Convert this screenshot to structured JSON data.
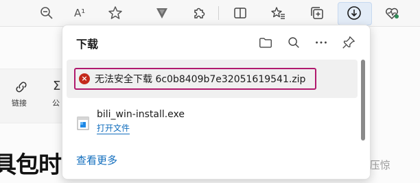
{
  "toolbar": {
    "icons": [
      "zoom-out-icon",
      "read-aloud-icon",
      "favorite-star-icon",
      "vivaldi-extension-icon",
      "extensions-puzzle-icon",
      "split-screen-icon",
      "favorites-list-icon",
      "collections-icon",
      "downloads-icon",
      "browser-essentials-icon"
    ],
    "read_aloud_glyph": "A¹"
  },
  "page": {
    "link_label": "链接",
    "sigma_glyph": "Σ",
    "sigma_label": "公",
    "heading": "具包时",
    "watermark": "知乎 @吃颗葡萄压压惊"
  },
  "downloads": {
    "title": "下载",
    "actions": [
      "open-folder",
      "search",
      "more",
      "pin"
    ],
    "items": [
      {
        "status": "error",
        "status_glyph": "×",
        "text": "无法安全下载 6c0b8409b7e32051619541.zip"
      },
      {
        "status": "complete",
        "name": "bili_win-install.exe",
        "action": "打开文件"
      }
    ],
    "more_link": "查看更多"
  },
  "colors": {
    "accent": "#0f6cbd",
    "error": "#c42b1c",
    "highlight": "#b0196d"
  }
}
